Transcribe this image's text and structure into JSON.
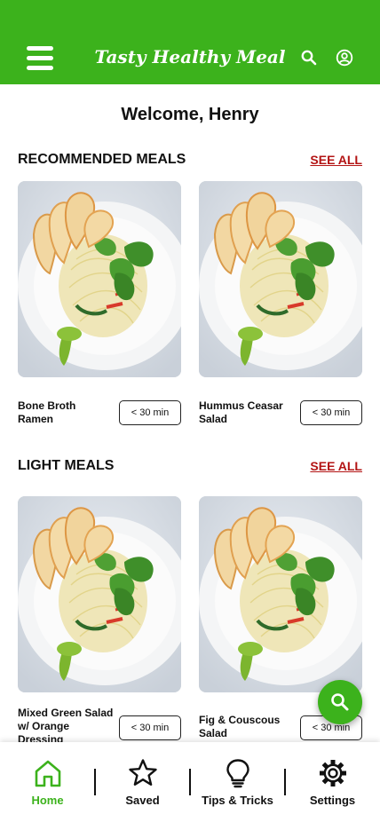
{
  "header": {
    "title": "Tasty Healthy Meal",
    "menu_icon": "hamburger-menu-icon",
    "search_icon": "search-icon",
    "profile_icon": "user-circle-icon",
    "bg_color": "#3cb21c"
  },
  "welcome": "Welcome, Henry",
  "sections": [
    {
      "title": "RECOMMENDED MEALS",
      "see_all": "SEE ALL",
      "meals": [
        {
          "name": "Bone Broth Ramen",
          "time": "< 30 min"
        },
        {
          "name": "Hummus Ceasar Salad",
          "time": "< 30 min"
        }
      ]
    },
    {
      "title": "LIGHT MEALS",
      "see_all": "SEE ALL",
      "meals": [
        {
          "name": "Mixed Green Salad w/ Orange Dressing",
          "time": "< 30 min"
        },
        {
          "name": "Fig & Couscous Salad",
          "time": "< 30 min"
        }
      ]
    }
  ],
  "fab_icon": "search-icon",
  "nav": [
    {
      "label": "Home",
      "icon": "home-icon",
      "active": true
    },
    {
      "label": "Saved",
      "icon": "star-icon",
      "active": false
    },
    {
      "label": "Tips & Tricks",
      "icon": "lightbulb-icon",
      "active": false
    },
    {
      "label": "Settings",
      "icon": "gear-icon",
      "active": false
    }
  ],
  "colors": {
    "accent": "#3cb21c",
    "link": "#b31414"
  }
}
